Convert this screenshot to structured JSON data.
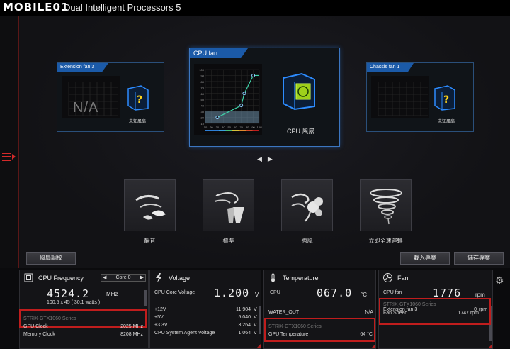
{
  "window": {
    "title": "Dual Intelligent Processors 5",
    "logo_text": "MOBILE01"
  },
  "fans": {
    "ext3": {
      "label": "Extension fan 3",
      "na_text": "N/A",
      "caption": "未知風扇"
    },
    "cpu": {
      "label": "CPU fan",
      "caption": "CPU 風扇",
      "y_ticks": [
        "100",
        "90",
        "80",
        "70",
        "60",
        "50",
        "40",
        "30",
        "20",
        "10"
      ],
      "x_ticks": [
        "10",
        "20",
        "30",
        "40",
        "50",
        "60",
        "70",
        "80",
        "90",
        "100"
      ],
      "x_unit": "°C",
      "curve_points": [
        [
          30,
          20
        ],
        [
          70,
          40
        ],
        [
          75,
          60
        ],
        [
          90,
          90
        ]
      ]
    },
    "chassis1": {
      "label": "Chassis fan 1",
      "caption": "未知風扇"
    }
  },
  "nav_arrows": {
    "prev": "◀",
    "next": "▶"
  },
  "modes": [
    {
      "label": "靜音",
      "icon": "silent-leaf-icon"
    },
    {
      "label": "標準",
      "icon": "standard-wind-icon"
    },
    {
      "label": "強風",
      "icon": "turbo-wind-icon"
    },
    {
      "label": "立即全速運轉",
      "icon": "full-speed-tornado-icon"
    }
  ],
  "buttons": {
    "fan_tuning": "風扇調校",
    "load_profile": "載入專案",
    "save_profile": "儲存專案"
  },
  "cpu_freq": {
    "title": "CPU Frequency",
    "core_select": "Core 0",
    "value": "4524.2",
    "unit": "MHz",
    "detail": "100.5  x  45  ( 30.1    watts )",
    "gpu_series": "STRIX-GTX1060 Series",
    "gpu_rows": [
      {
        "label": "GPU Clock",
        "value": "2025 MHz"
      },
      {
        "label": "Memory Clock",
        "value": "8208 MHz"
      }
    ]
  },
  "voltage": {
    "title": "Voltage",
    "main_label": "CPU Core Voltage",
    "main_value": "1.200",
    "main_unit": "V",
    "rows": [
      {
        "label": "+12V",
        "value": "11.904",
        "unit": "V"
      },
      {
        "label": "+5V",
        "value": "5.040",
        "unit": "V"
      },
      {
        "label": "+3.3V",
        "value": "3.264",
        "unit": "V"
      },
      {
        "label": "CPU System Agent Voltage",
        "value": "1.064",
        "unit": "V"
      }
    ]
  },
  "temperature": {
    "title": "Temperature",
    "main_label": "CPU",
    "main_value": "067.0",
    "main_unit": "°C",
    "row": {
      "label": "WATER_OUT",
      "value": "N/A"
    },
    "gpu_series": "STRIX-GTX1060 Series",
    "gpu_row": {
      "label": "GPU Temperature",
      "value": "64 °C"
    }
  },
  "fan": {
    "title": "Fan",
    "main_label": "CPU fan",
    "main_value": "1776",
    "main_unit": "rpm",
    "row": {
      "label": "Extension fan 3",
      "value": "0",
      "unit": "rpm"
    },
    "gpu_series": "STRIX-GTX1060 Series",
    "gpu_row": {
      "label": "Fan Speed",
      "value": "1747 rpm"
    }
  },
  "colors": {
    "accent_red": "#c01d1d",
    "accent_blue": "#1b5aa8",
    "chart_fill": "#6e8fa8"
  }
}
